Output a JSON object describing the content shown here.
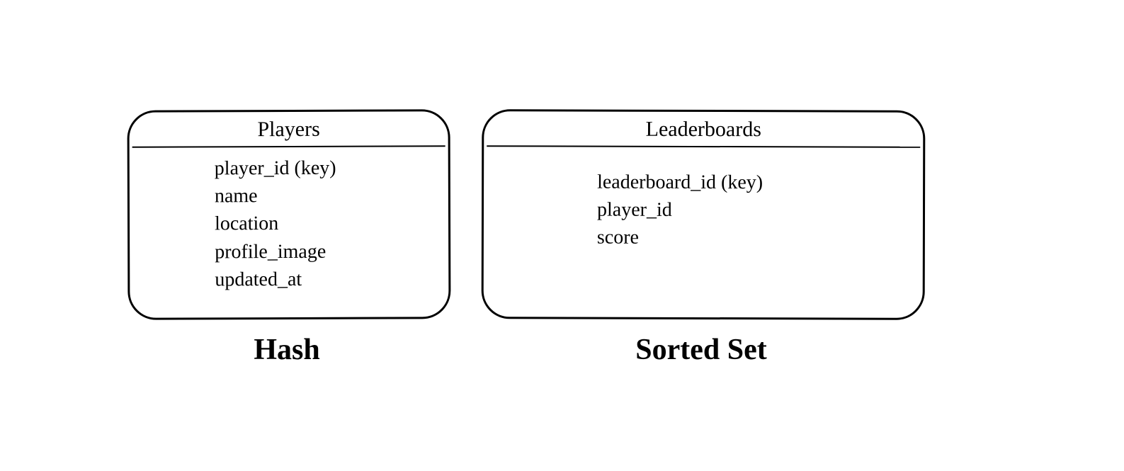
{
  "entities": {
    "players": {
      "title": "Players",
      "fields": [
        "player_id (key)",
        "name",
        "location",
        "profile_image",
        "updated_at"
      ],
      "type_label": "Hash"
    },
    "leaderboards": {
      "title": "Leaderboards",
      "fields": [
        "leaderboard_id (key)",
        "player_id",
        "score"
      ],
      "type_label": "Sorted Set"
    }
  }
}
